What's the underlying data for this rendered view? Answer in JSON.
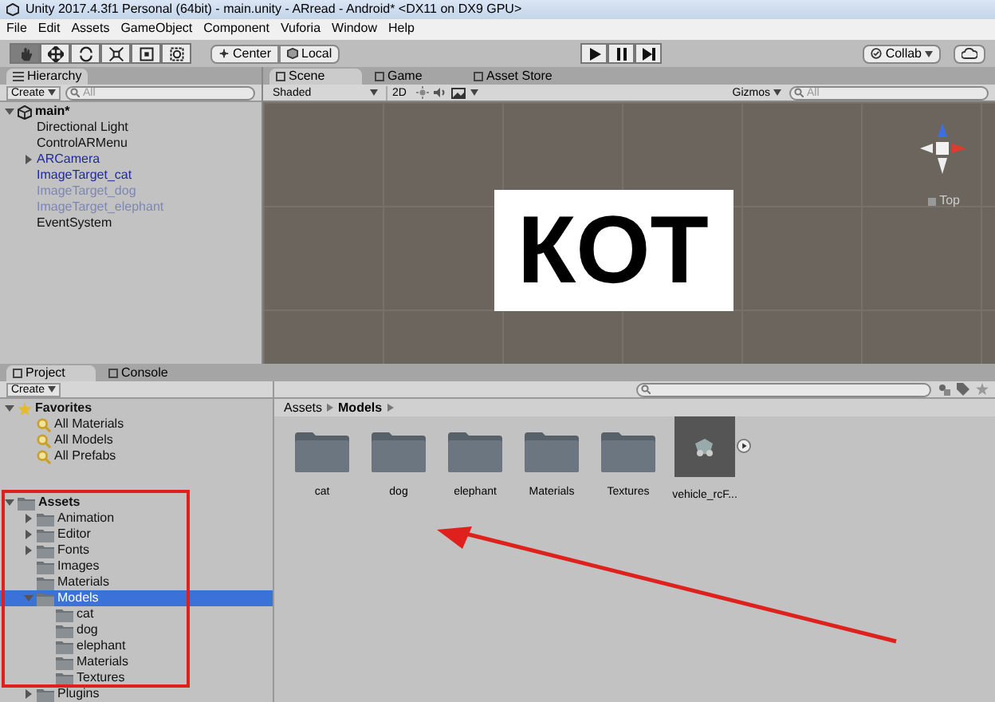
{
  "window": {
    "title": "Unity 2017.4.3f1 Personal (64bit) - main.unity - ARread - Android* <DX11 on DX9 GPU>"
  },
  "menu": [
    "File",
    "Edit",
    "Assets",
    "GameObject",
    "Component",
    "Vuforia",
    "Window",
    "Help"
  ],
  "tools": [
    {
      "selected": true
    },
    {
      "selected": false
    },
    {
      "selected": false
    },
    {
      "selected": false
    },
    {
      "selected": false
    },
    {
      "selected": false
    }
  ],
  "pivot": {
    "center": "Center",
    "local": "Local"
  },
  "collab": "Collab",
  "hierarchy": {
    "tab": "Hierarchy",
    "create": "Create",
    "search_placeholder": "All",
    "tree": [
      {
        "label": "main*",
        "kind": "scene",
        "expanded": true,
        "children": [
          {
            "label": "Directional Light",
            "kind": "object"
          },
          {
            "label": "ControlARMenu",
            "kind": "object"
          },
          {
            "label": "ARCamera",
            "kind": "prefab",
            "expanded": false
          },
          {
            "label": "ImageTarget_cat",
            "kind": "prefab"
          },
          {
            "label": "ImageTarget_dog",
            "kind": "prefab_inactive"
          },
          {
            "label": "ImageTarget_elephant",
            "kind": "prefab_inactive"
          },
          {
            "label": "EventSystem",
            "kind": "object"
          }
        ]
      }
    ]
  },
  "scene_tabs": [
    {
      "label": "Scene",
      "selected": true
    },
    {
      "label": "Game",
      "selected": false
    },
    {
      "label": "Asset Store",
      "selected": false
    }
  ],
  "scene_toolbar": {
    "shading": "Shaded",
    "mode": "2D",
    "gizmos": "Gizmos",
    "search_placeholder": "All"
  },
  "scene": {
    "card_text": "КОТ",
    "view_label": "Top"
  },
  "bottom_tabs": [
    {
      "label": "Project",
      "selected": true
    },
    {
      "label": "Console",
      "selected": false
    }
  ],
  "project": {
    "create": "Create",
    "tree": [
      {
        "label": "Favorites",
        "kind": "favorites",
        "expanded": true,
        "children": [
          {
            "label": "All Materials",
            "kind": "search"
          },
          {
            "label": "All Models",
            "kind": "search"
          },
          {
            "label": "All Prefabs",
            "kind": "search"
          }
        ]
      },
      {
        "label": "Assets",
        "kind": "root",
        "expanded": true,
        "children": [
          {
            "label": "Animation",
            "kind": "folder",
            "expanded": false
          },
          {
            "label": "Editor",
            "kind": "folder",
            "expanded": false
          },
          {
            "label": "Fonts",
            "kind": "folder",
            "expanded": false
          },
          {
            "label": "Images",
            "kind": "folder"
          },
          {
            "label": "Materials",
            "kind": "folder"
          },
          {
            "label": "Models",
            "kind": "folder",
            "expanded": true,
            "selected": true,
            "children": [
              {
                "label": "cat",
                "kind": "folder",
                "selected": false
              },
              {
                "label": "dog",
                "kind": "folder",
                "selected": false
              },
              {
                "label": "elephant",
                "kind": "folder",
                "selected": false
              },
              {
                "label": "Materials",
                "kind": "folder",
                "selected": false
              },
              {
                "label": "Textures",
                "kind": "folder",
                "selected": false
              }
            ]
          },
          {
            "label": "Plugins",
            "kind": "folder",
            "expanded": false
          }
        ]
      }
    ],
    "breadcrumb": [
      "Assets",
      "Models"
    ],
    "items": [
      {
        "name": "cat",
        "kind": "folder"
      },
      {
        "name": "dog",
        "kind": "folder"
      },
      {
        "name": "elephant",
        "kind": "folder"
      },
      {
        "name": "Materials",
        "kind": "folder"
      },
      {
        "name": "Textures",
        "kind": "folder"
      },
      {
        "name": "vehicle_rcF...",
        "kind": "model"
      }
    ]
  }
}
